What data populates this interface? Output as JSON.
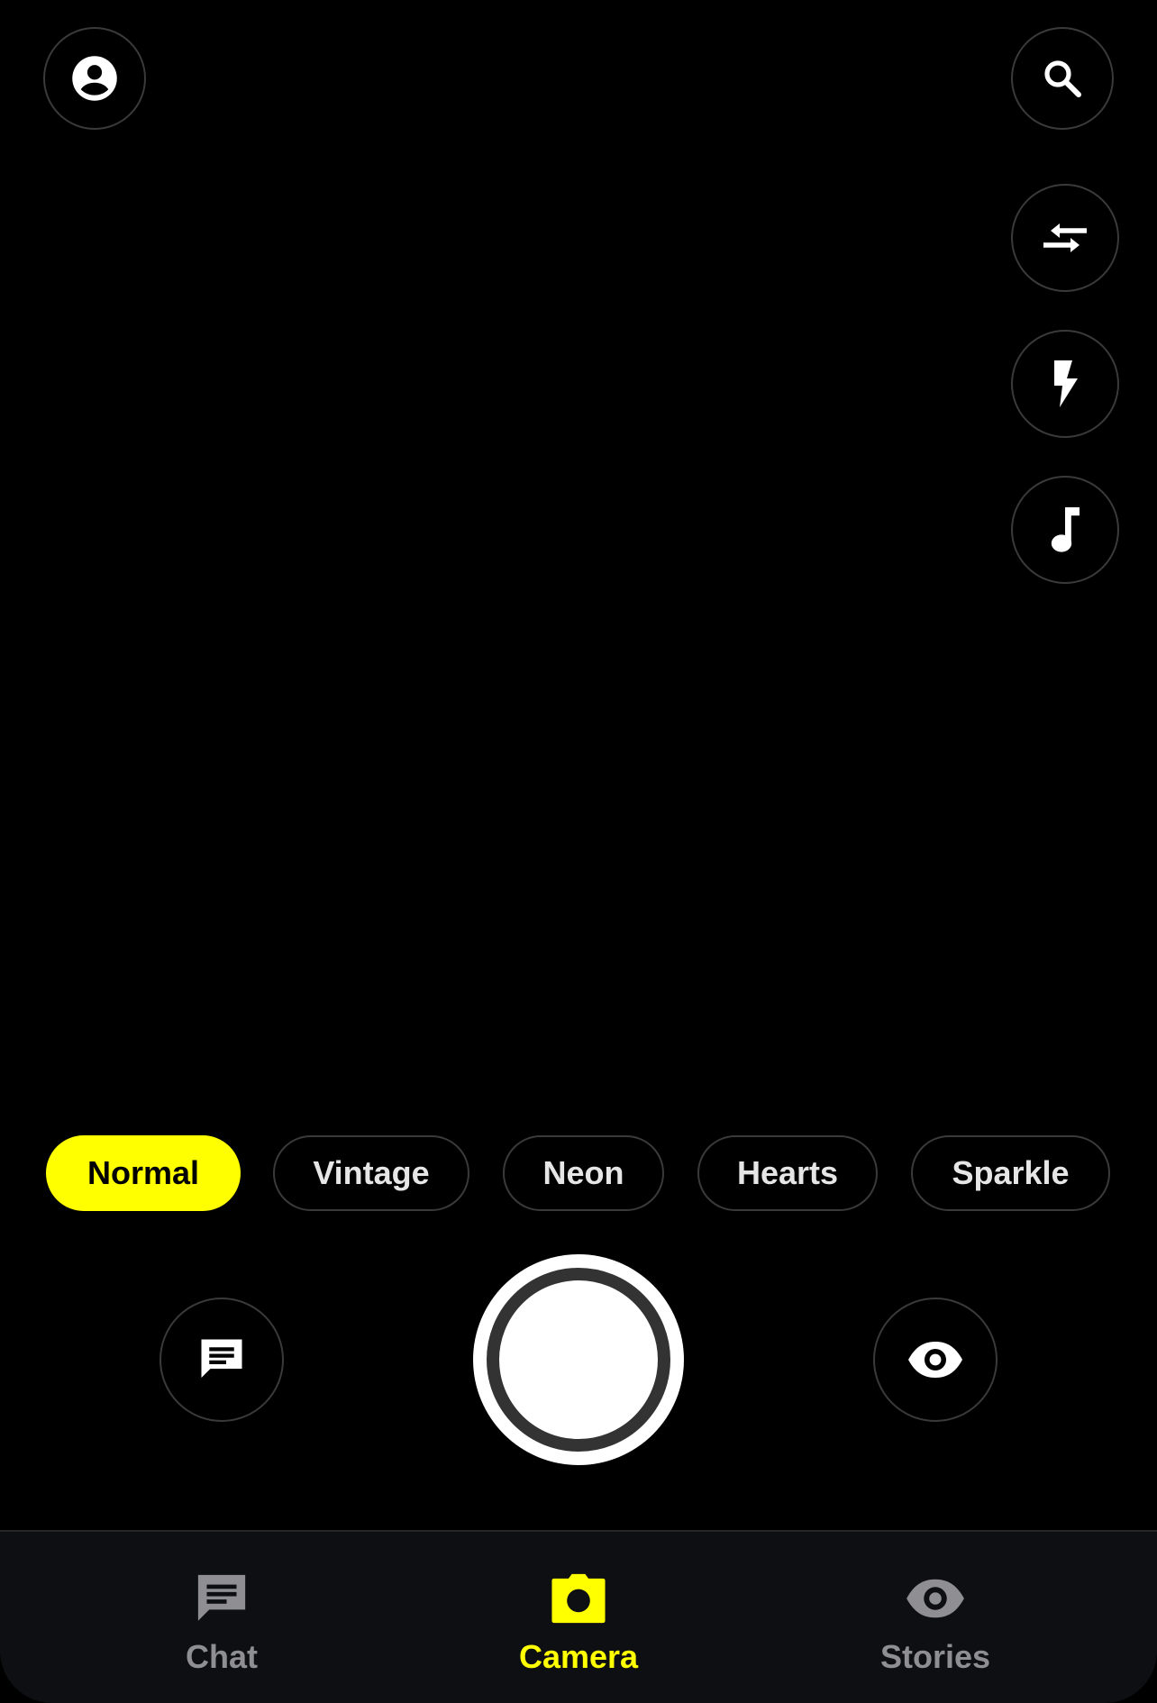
{
  "top_controls": {
    "profile_icon": "account-circle-icon",
    "search_icon": "search-icon"
  },
  "side_controls": [
    {
      "id": "flip",
      "icon": "flip-camera-icon"
    },
    {
      "id": "flash",
      "icon": "flash-icon"
    },
    {
      "id": "music",
      "icon": "music-note-icon"
    }
  ],
  "filters": [
    {
      "label": "Normal",
      "selected": true
    },
    {
      "label": "Vintage",
      "selected": false
    },
    {
      "label": "Neon",
      "selected": false
    },
    {
      "label": "Hearts",
      "selected": false
    },
    {
      "label": "Sparkle",
      "selected": false
    }
  ],
  "capture_row": {
    "left_icon": "chat-icon",
    "right_icon": "eye-icon"
  },
  "bottom_nav": {
    "items": [
      {
        "label": "Chat",
        "icon": "chat-icon",
        "active": false
      },
      {
        "label": "Camera",
        "icon": "camera-icon",
        "active": true
      },
      {
        "label": "Stories",
        "icon": "eye-icon",
        "active": false
      }
    ]
  },
  "colors": {
    "accent": "#ffff00",
    "background": "#000000",
    "nav_background": "#0e0f12",
    "inactive": "#8e8e93"
  }
}
